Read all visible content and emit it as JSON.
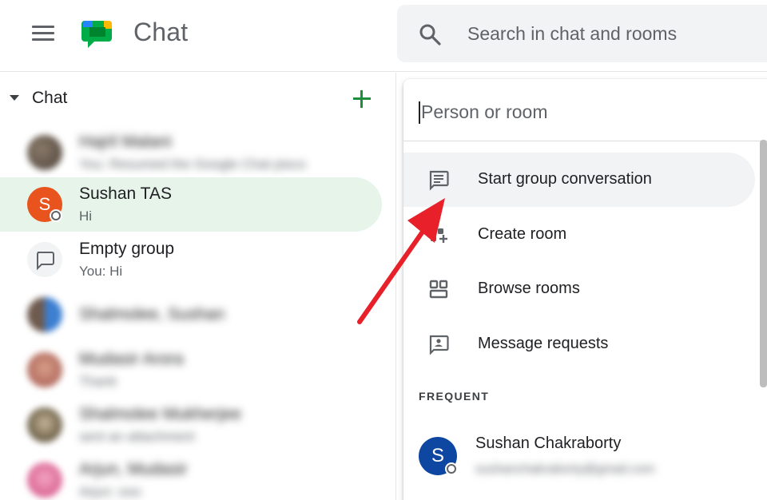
{
  "header": {
    "app_title": "Chat",
    "menu_icon": "hamburger-menu-icon",
    "logo_icon": "google-chat-logo",
    "search_placeholder": "Search in chat and rooms"
  },
  "sidebar": {
    "section_title": "Chat",
    "add_icon": "plus-icon",
    "conversations": [
      {
        "name": "Hajril Malani",
        "subtitle": "You: Resumed the Google Chat pisco",
        "blurred": true
      },
      {
        "name": "Sushan TAS",
        "subtitle": "Hi",
        "initial": "S",
        "selected": true,
        "avatar_color": "#e8531e"
      },
      {
        "name": "Empty group",
        "subtitle": "You: Hi",
        "icon": "chat-bubble-icon"
      },
      {
        "name": "Shalmolee, Sushan",
        "subtitle": "",
        "blurred": true
      },
      {
        "name": "Mudasir Arora",
        "subtitle": "Thank",
        "blurred": true
      },
      {
        "name": "Shalmolee Mukherjee",
        "subtitle": "sent an attachment",
        "blurred": true
      },
      {
        "name": "Arjun, Mudasir",
        "subtitle": "Arjun: ooo",
        "blurred": true
      }
    ]
  },
  "panel": {
    "input_placeholder": "Person or room",
    "menu": [
      {
        "label": "Start group conversation",
        "icon": "chat-lines-icon",
        "active": true
      },
      {
        "label": "Create room",
        "icon": "create-room-icon"
      },
      {
        "label": "Browse rooms",
        "icon": "browse-rooms-icon"
      },
      {
        "label": "Message requests",
        "icon": "message-requests-icon"
      }
    ],
    "frequent_label": "FREQUENT",
    "frequent": [
      {
        "name": "Sushan Chakraborty",
        "email": "sushanchakraborty@gmail.com",
        "initial": "S"
      }
    ]
  },
  "colors": {
    "accent_green": "#1e8e3e",
    "selected_bg": "#e6f4ea",
    "annotation_arrow": "#e8202a"
  }
}
